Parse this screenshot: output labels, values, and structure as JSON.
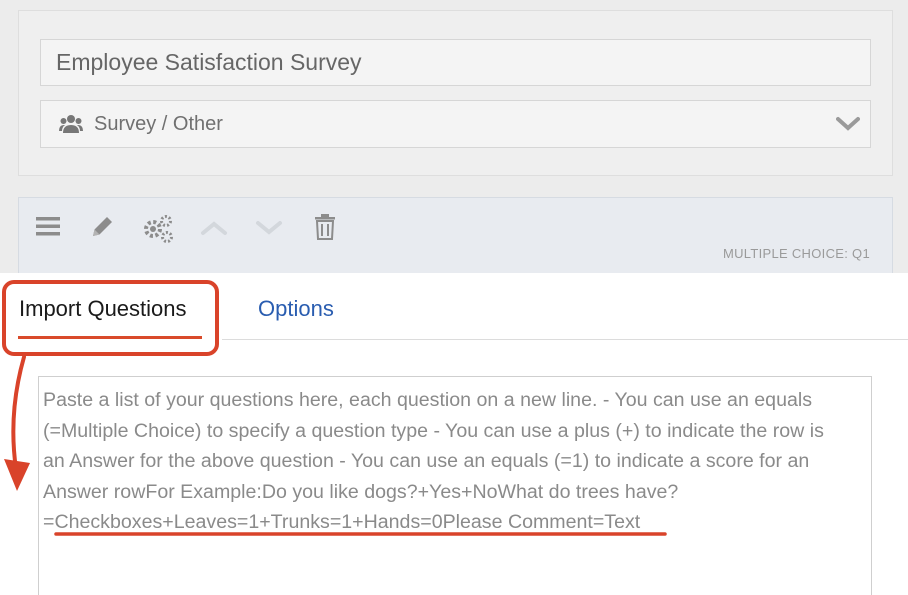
{
  "survey": {
    "title": "Employee Satisfaction Survey",
    "category": "Survey / Other"
  },
  "question": {
    "type_label": "MULTIPLE CHOICE: Q1"
  },
  "toolbar": {
    "icons": [
      "menu-icon",
      "pencil-icon",
      "gears-icon",
      "chevron-up-icon",
      "chevron-down-icon",
      "trash-icon"
    ]
  },
  "import_panel": {
    "tabs": [
      {
        "label": "Import Questions",
        "active": true
      },
      {
        "label": "Options",
        "active": false
      }
    ],
    "placeholder": "Paste a list of your questions here, each question on a new line. - You can use an equals\n(=Multiple Choice) to specify a question type - You can use a plus (+) to indicate the row is\nan Answer for the above question - You can use an equals (=1) to indicate a score for an\nAnswer rowFor Example:Do you like dogs?+Yes+NoWhat do trees have?\n=Checkboxes+Leaves=1+Trunks=1+Hands=0Please Comment=Text"
  },
  "colors": {
    "highlight": "#d9432a",
    "tab_link": "#2a5db0",
    "toolbar_bg": "#e8ebf0"
  }
}
